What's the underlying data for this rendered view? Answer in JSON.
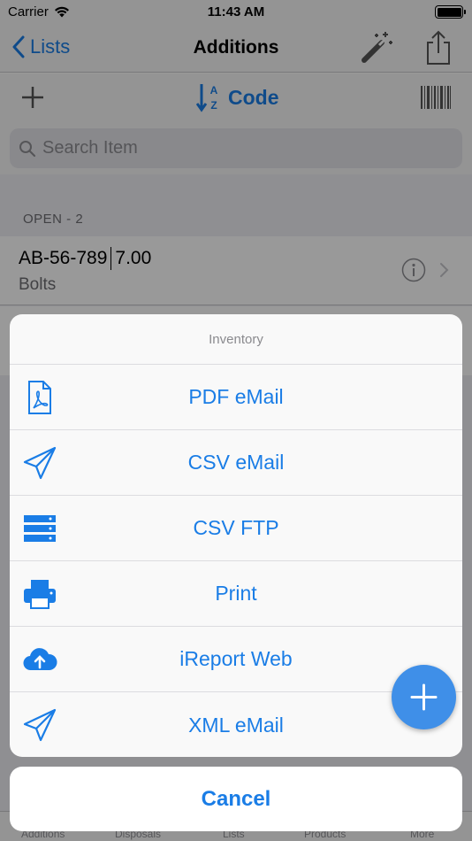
{
  "status_bar": {
    "carrier": "Carrier",
    "time": "11:43 AM"
  },
  "nav": {
    "back_label": "Lists",
    "title": "Additions",
    "icons": [
      "magic-wand-icon",
      "share-icon"
    ]
  },
  "toolbar": {
    "sort_label": "Code",
    "icons": [
      "add-icon",
      "sort-az-icon",
      "barcode-icon"
    ]
  },
  "search": {
    "placeholder": "Search Item"
  },
  "list": {
    "section_header": "OPEN - 2",
    "items": [
      {
        "code": "AB-56-789",
        "quantity": "7.00",
        "name": "Bolts"
      }
    ]
  },
  "tab_bar": {
    "labels": [
      "Additions",
      "Disposals",
      "Lists",
      "Products",
      "More"
    ]
  },
  "action_sheet": {
    "title": "Inventory",
    "items": [
      {
        "label": "PDF eMail",
        "icon": "pdf-file-icon"
      },
      {
        "label": "CSV eMail",
        "icon": "paper-plane-icon"
      },
      {
        "label": "CSV FTP",
        "icon": "server-icon"
      },
      {
        "label": "Print",
        "icon": "printer-icon"
      },
      {
        "label": "iReport Web",
        "icon": "cloud-upload-icon"
      },
      {
        "label": "XML eMail",
        "icon": "paper-plane-icon"
      }
    ],
    "cancel_label": "Cancel"
  },
  "colors": {
    "accent": "#1a7de6",
    "fab": "#3f8fe8"
  }
}
